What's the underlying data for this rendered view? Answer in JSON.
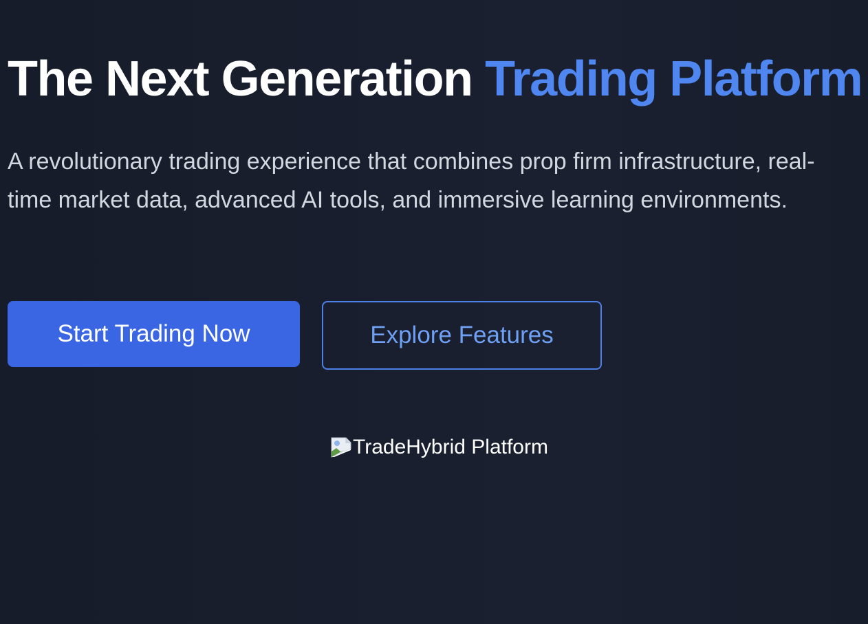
{
  "hero": {
    "title_main": "The Next Generation ",
    "title_accent": "Trading Platform",
    "subtitle": "A revolutionary trading experience that combines prop firm infrastructure, real-time market data, advanced AI tools, and immersive learning environments.",
    "primary_button_label": "Start Trading Now",
    "secondary_button_label": "Explore Features",
    "image_alt_text": "TradeHybrid Platform",
    "image_icon": "broken-image-icon"
  },
  "colors": {
    "background": "#171d2a",
    "accent": "#4f86f0",
    "primary_button": "#3a66e3",
    "secondary_border": "#4e80ea",
    "secondary_text": "#6ea0f4"
  }
}
